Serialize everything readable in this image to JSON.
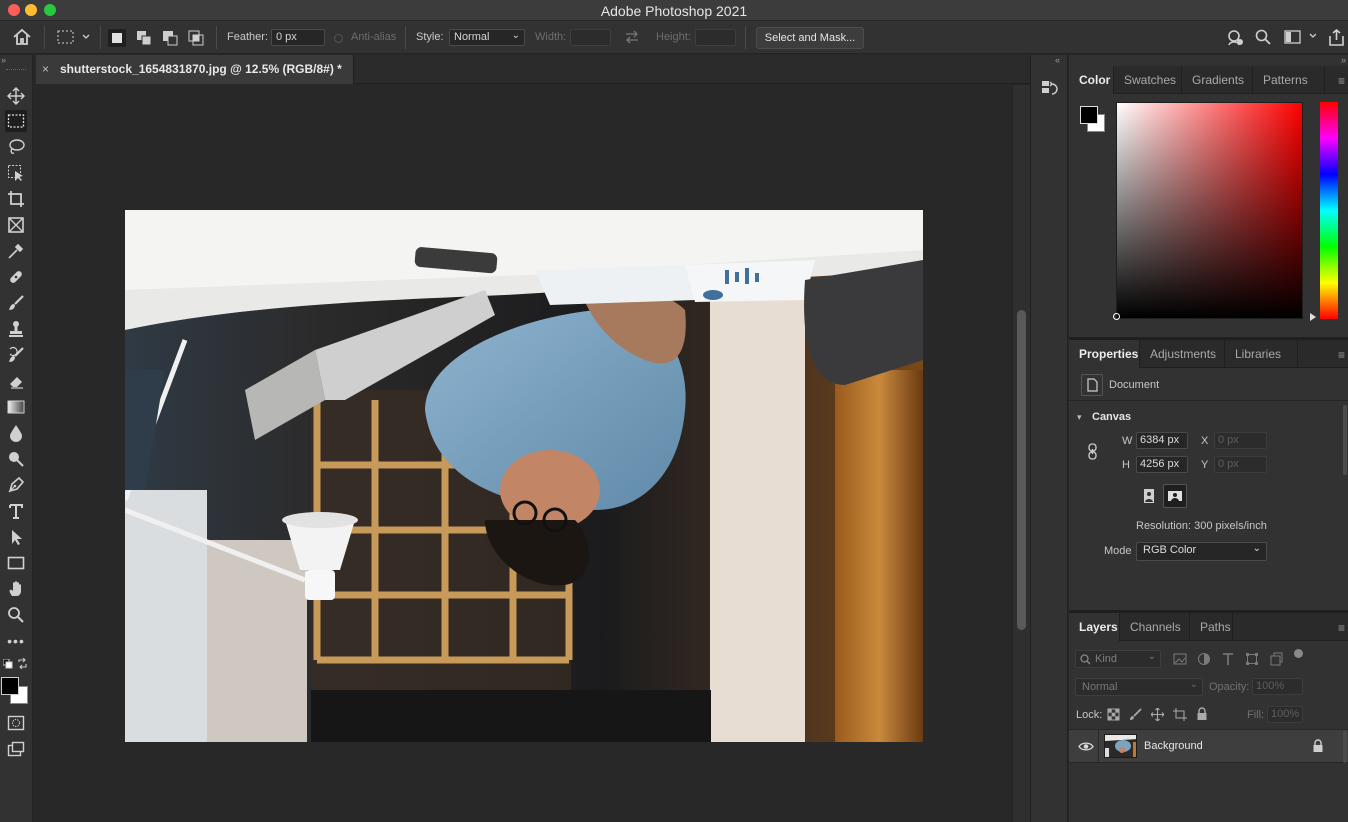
{
  "window": {
    "title": "Adobe Photoshop 2021"
  },
  "options_bar": {
    "feather_label": "Feather:",
    "feather_value": "0 px",
    "antialias_label": "Anti-alias",
    "style_label": "Style:",
    "style_value": "Normal",
    "width_label": "Width:",
    "height_label": "Height:",
    "select_mask_label": "Select and Mask..."
  },
  "document": {
    "tab_title": "shutterstock_1654831870.jpg @ 12.5% (RGB/8#) *",
    "close_glyph": "×"
  },
  "color_panel": {
    "tabs": [
      "Color",
      "Swatches",
      "Gradients",
      "Patterns"
    ],
    "foreground": "#000000",
    "background": "#ffffff",
    "hue_base": "#ff0000"
  },
  "properties_panel": {
    "tabs": [
      "Properties",
      "Adjustments",
      "Libraries"
    ],
    "type_label": "Document",
    "section_title": "Canvas",
    "w_label": "W",
    "w_value": "6384 px",
    "h_label": "H",
    "h_value": "4256 px",
    "x_label": "X",
    "x_placeholder": "0 px",
    "y_label": "Y",
    "y_placeholder": "0 px",
    "resolution": "Resolution: 300 pixels/inch",
    "mode_label": "Mode",
    "mode_value": "RGB Color"
  },
  "layers_panel": {
    "tabs": [
      "Layers",
      "Channels",
      "Paths"
    ],
    "filter_placeholder": "Kind",
    "blend_mode": "Normal",
    "opacity_label": "Opacity:",
    "opacity_value": "100%",
    "lock_label": "Lock:",
    "fill_label": "Fill:",
    "fill_value": "100%",
    "layers": [
      {
        "name": "Background",
        "visible": true,
        "locked": true
      }
    ]
  },
  "colors": {
    "ui_accent": "#e8e8e8",
    "traffic_close": "#ff5f57",
    "traffic_min": "#febc2e",
    "traffic_max": "#28c840"
  }
}
